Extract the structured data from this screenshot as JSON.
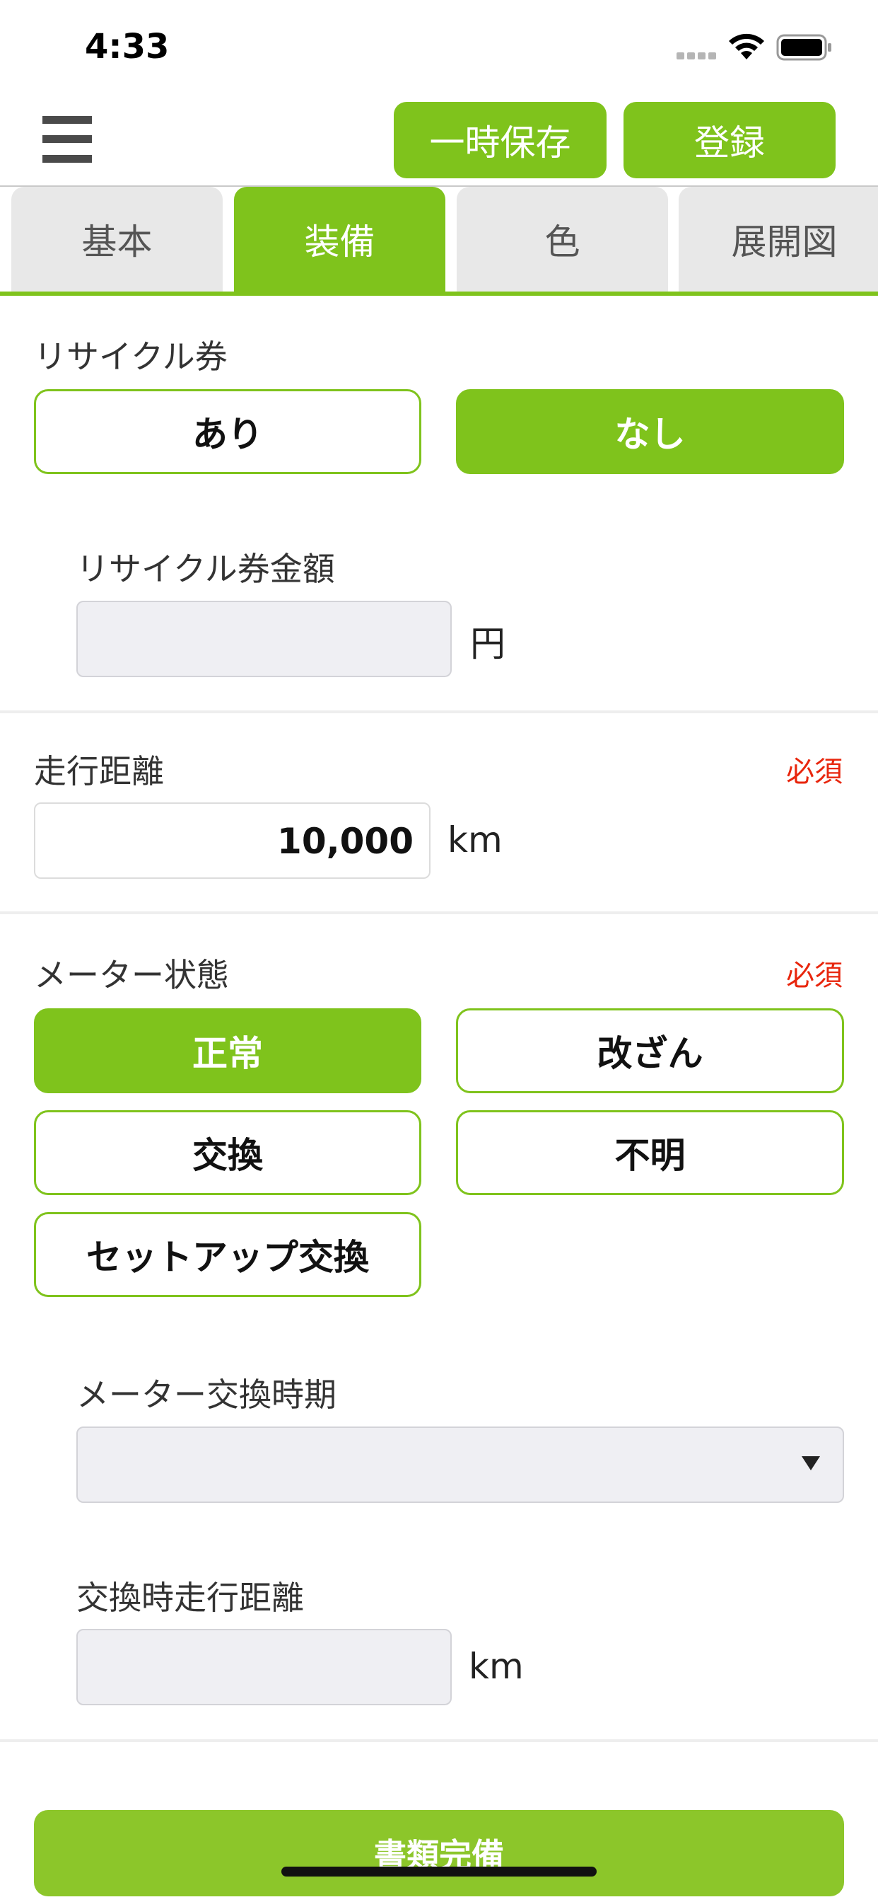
{
  "status": {
    "time": "4:33"
  },
  "header": {
    "temp_save_label": "一時保存",
    "register_label": "登録"
  },
  "tabs": [
    {
      "label": "基本",
      "active": false
    },
    {
      "label": "装備",
      "active": true
    },
    {
      "label": "色",
      "active": false
    },
    {
      "label": "展開図",
      "active": false
    }
  ],
  "recycle": {
    "label": "リサイクル券",
    "options": [
      "あり",
      "なし"
    ],
    "selected": "なし",
    "amount_label": "リサイクル券金額",
    "amount_value": "",
    "amount_unit": "円"
  },
  "mileage": {
    "label": "走行距離",
    "required": "必須",
    "value": "10,000",
    "unit": "km"
  },
  "meter": {
    "label": "メーター状態",
    "required": "必須",
    "options": [
      "正常",
      "改ざん",
      "交換",
      "不明",
      "セットアップ交換"
    ],
    "selected": "正常",
    "exchange_period_label": "メーター交換時期",
    "exchange_period_value": "",
    "exchange_mileage_label": "交換時走行距離",
    "exchange_mileage_value": "",
    "exchange_mileage_unit": "km"
  },
  "footer": {
    "documents_complete_label": "書類完備"
  },
  "colors": {
    "accent": "#7fc31c",
    "required": "#e8260d",
    "tab_inactive": "#e8e8e8",
    "input_bg": "#efeff3"
  }
}
